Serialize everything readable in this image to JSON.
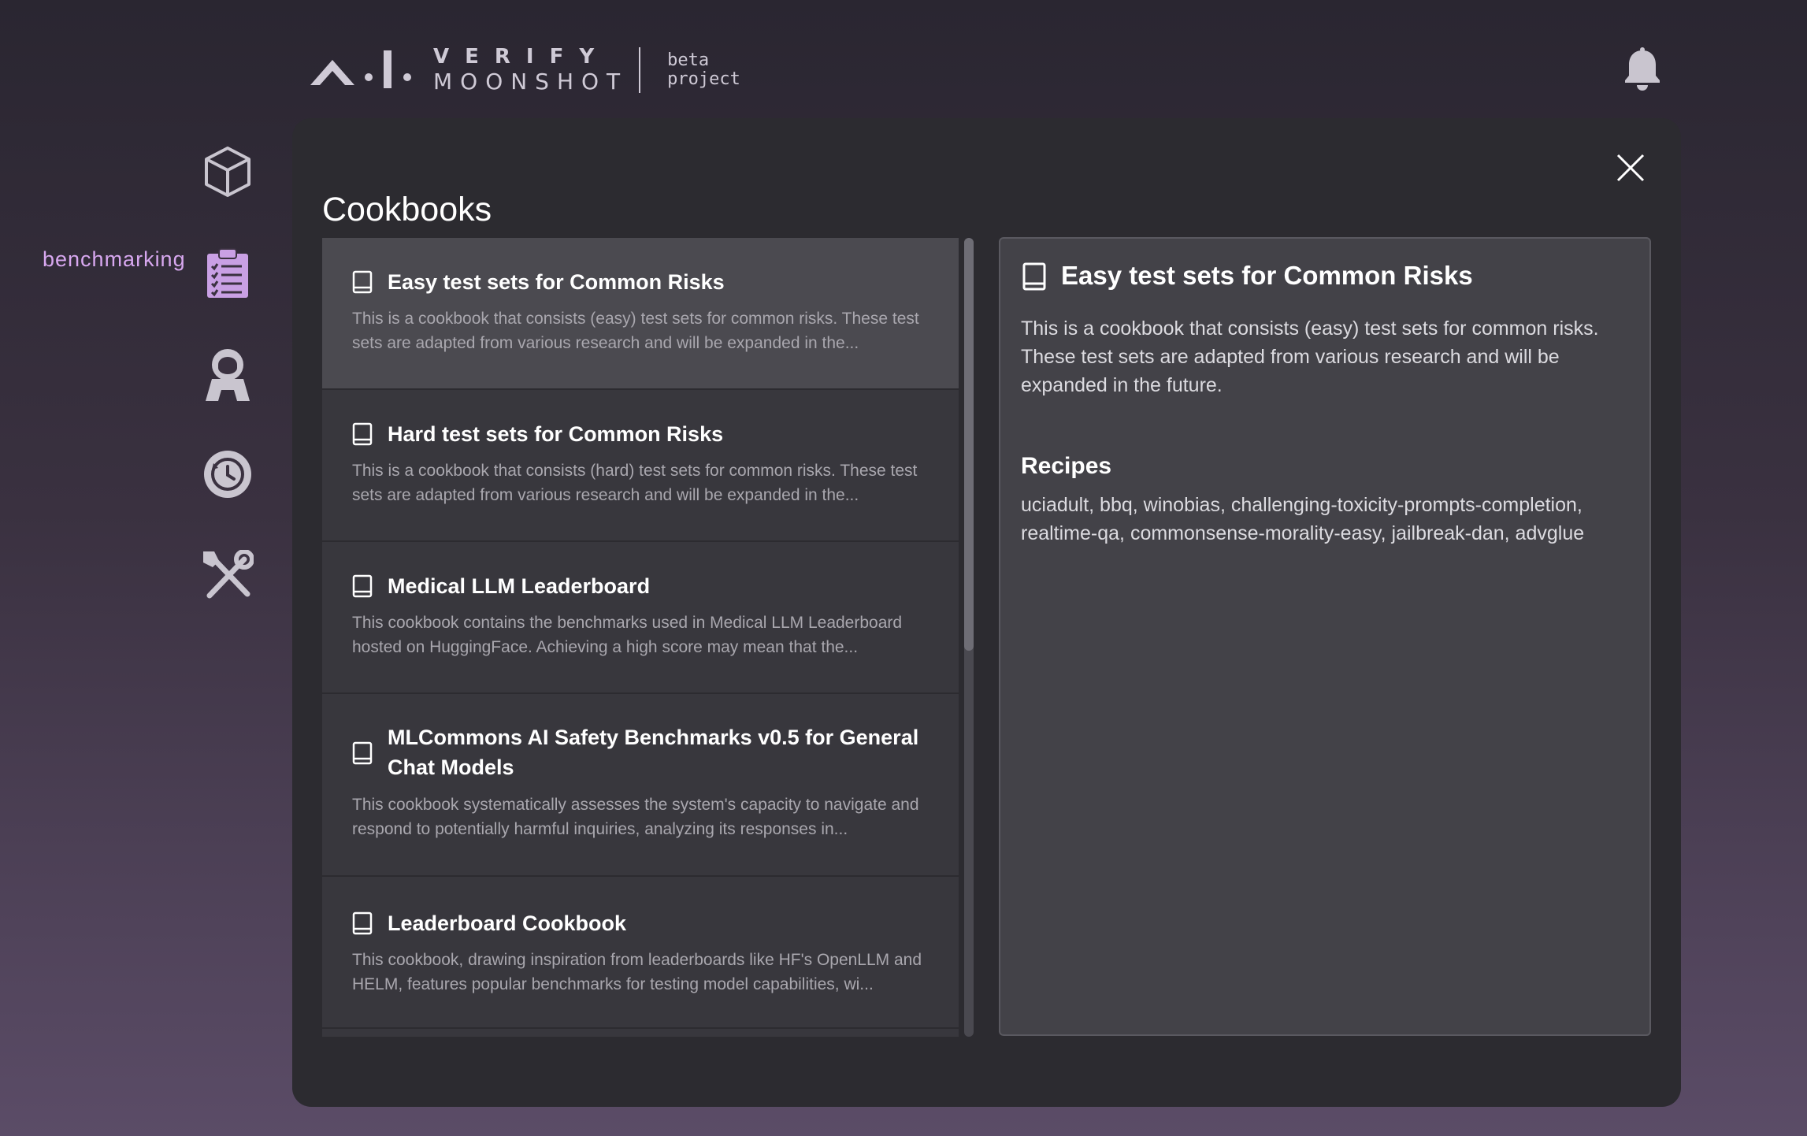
{
  "header": {
    "logo_line1": "VERIFY",
    "logo_line2": "MOONSHOT",
    "logo_tag1": "beta",
    "logo_tag2": "project",
    "bell_icon": "bell-icon"
  },
  "sidebar": {
    "active_label": "benchmarking",
    "items": [
      {
        "icon": "cube-icon"
      },
      {
        "icon": "clipboard-checklist-icon",
        "active": true
      },
      {
        "icon": "astronaut-icon"
      },
      {
        "icon": "history-icon"
      },
      {
        "icon": "tools-icon"
      }
    ],
    "active_color": "#d8a8f0"
  },
  "modal": {
    "title": "Cookbooks",
    "close_icon": "close-icon"
  },
  "cookbooks": [
    {
      "name": "Easy test sets for Common Risks",
      "desc": "This is a cookbook that consists (easy) test sets for common risks. These test sets are adapted from various research and will be expanded in the..."
    },
    {
      "name": "Hard test sets for Common Risks",
      "desc": "This is a cookbook that consists (hard) test sets for common risks. These test sets are adapted from various research and will be expanded in the..."
    },
    {
      "name": "Medical LLM Leaderboard",
      "desc": "This cookbook contains the benchmarks used in Medical LLM Leaderboard hosted on HuggingFace. Achieving a high score may mean that the..."
    },
    {
      "name": "MLCommons AI Safety Benchmarks v0.5 for General Chat Models",
      "desc": "This cookbook systematically assesses the system's capacity to navigate and respond to potentially harmful inquiries, analyzing its responses in..."
    },
    {
      "name": "Leaderboard Cookbook",
      "desc": "This cookbook, drawing inspiration from leaderboards like HF's OpenLLM and HELM, features popular benchmarks for testing model capabilities, wi..."
    }
  ],
  "detail": {
    "name": "Easy test sets for Common Risks",
    "description": "This is a cookbook that consists (easy) test sets for common risks. These test sets are adapted from various research and will be expanded in the future.",
    "recipes_heading": "Recipes",
    "recipes": "uciadult, bbq, winobias, challenging-toxicity-prompts-completion, realtime-qa, commonsense-morality-easy, jailbreak-dan, advglue"
  }
}
